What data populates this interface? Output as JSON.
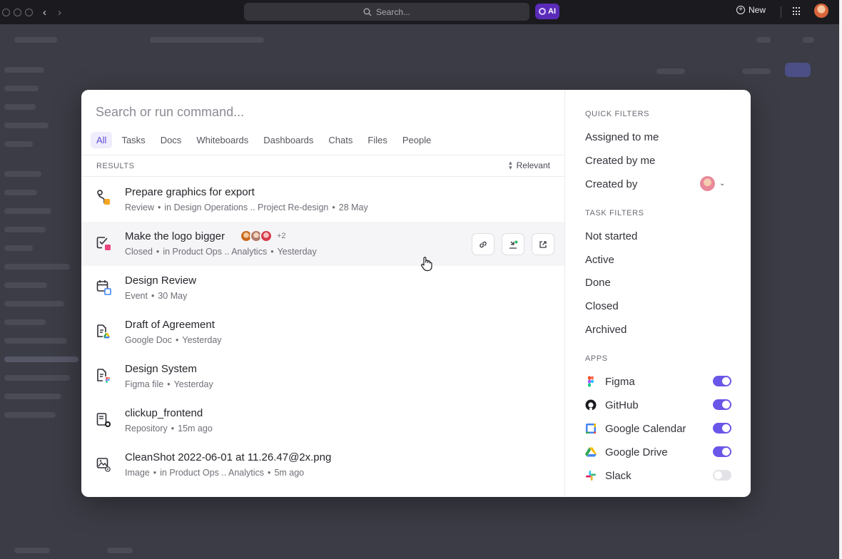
{
  "topbar": {
    "search_label": "Search...",
    "ai_label": "AI",
    "new_label": "New"
  },
  "modal": {
    "search_placeholder": "Search or run command...",
    "tabs": [
      {
        "label": "All",
        "active": true
      },
      {
        "label": "Tasks"
      },
      {
        "label": "Docs"
      },
      {
        "label": "Whiteboards"
      },
      {
        "label": "Dashboards"
      },
      {
        "label": "Chats"
      },
      {
        "label": "Files"
      },
      {
        "label": "People"
      }
    ],
    "results_heading": "RESULTS",
    "sort_label": "Relevant",
    "results": [
      {
        "title": "Prepare graphics for export",
        "meta": [
          "Review",
          "in Design Operations ..  Project Re-design",
          "28 May"
        ],
        "icon": "task-icon",
        "status_color": "#f5a623"
      },
      {
        "title": "Make the logo bigger",
        "meta": [
          "Closed",
          "in Product Ops ..  Analytics",
          "Yesterday"
        ],
        "icon": "task-done-icon",
        "status_color": "#e8467c",
        "assignees_more": "+2"
      },
      {
        "title": "Design Review",
        "meta": [
          "Event",
          "30 May"
        ],
        "icon": "calendar-event-icon"
      },
      {
        "title": "Draft of Agreement",
        "meta": [
          "Google Doc",
          "Yesterday"
        ],
        "icon": "google-doc-icon"
      },
      {
        "title": "Design System",
        "meta": [
          "Figma file",
          "Yesterday"
        ],
        "icon": "figma-file-icon"
      },
      {
        "title": "clickup_frontend",
        "meta": [
          "Repository",
          "15m ago"
        ],
        "icon": "github-repository-icon"
      },
      {
        "title": "CleanShot 2022-06-01 at 11.26.47@2x.png",
        "meta": [
          "Image",
          "in Product Ops ..  Analytics",
          "5m ago"
        ],
        "icon": "image-file-icon"
      }
    ],
    "quick_filters_heading": "QUICK FILTERS",
    "quick_filters": [
      "Assigned to me",
      "Created by me",
      "Created by"
    ],
    "task_filters_heading": "TASK FILTERS",
    "task_filters": [
      "Not started",
      "Active",
      "Done",
      "Closed",
      "Archived"
    ],
    "apps_heading": "APPS",
    "apps": [
      {
        "label": "Figma",
        "enabled": true
      },
      {
        "label": "GitHub",
        "enabled": true
      },
      {
        "label": "Google Calendar",
        "enabled": true
      },
      {
        "label": "Google Drive",
        "enabled": true
      },
      {
        "label": "Slack",
        "enabled": false
      }
    ],
    "colors": {
      "accent": "#6a56e8",
      "tab_active_bg": "#efedfb",
      "tab_active_text": "#5b4ad6"
    }
  }
}
